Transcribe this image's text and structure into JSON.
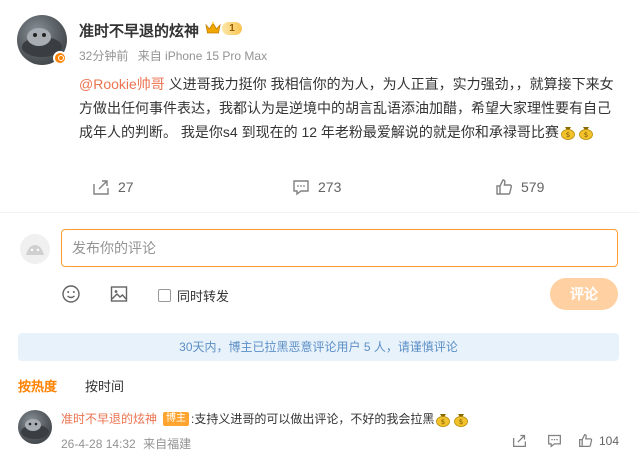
{
  "post": {
    "author": "准时不早退的炫神",
    "vip_level": "1",
    "time": "32分钟前",
    "source": "来自 iPhone 15 Pro Max",
    "mention": "@Rookie帅哥",
    "text_1": " 义进哥我力挺你 我相信你的为人，为人正直，实力强劲，，就算接下来女方做出任何事件表达，我都认为是逆境中的胡言乱语添油加醋，希望大家理性要有自己成年人的判断。 我是你s4 到现在的 12 年老粉最爱解说的就是你和承禄哥比赛",
    "emoji": "money-bag-emoji",
    "repost_count": "27",
    "comment_count": "273",
    "like_count": "579"
  },
  "composer": {
    "placeholder": "发布你的评论",
    "forward_label": "同时转发",
    "submit_label": "评论",
    "icons": [
      "smiley-icon",
      "image-icon"
    ]
  },
  "notice": "30天内，博主已拉黑恶意评论用户 5 人，请谨慎评论",
  "sort": {
    "tabs": [
      {
        "label": "按热度",
        "active": true
      },
      {
        "label": "按时间",
        "active": false
      }
    ]
  },
  "comments": [
    {
      "author": "准时不早退的炫神",
      "tag": "博主",
      "text": ":支持义进哥的可以做出评论，不好的我会拉黑",
      "time": "26-4-28 14:32",
      "source": "来自福建",
      "like_count": "104"
    }
  ],
  "colors": {
    "accent": "#ff8200",
    "mention": "#eb7350",
    "notice_bg": "#e8f2fb",
    "notice_text": "#5d8fc6",
    "submit_disabled": "#ffd0a2"
  }
}
